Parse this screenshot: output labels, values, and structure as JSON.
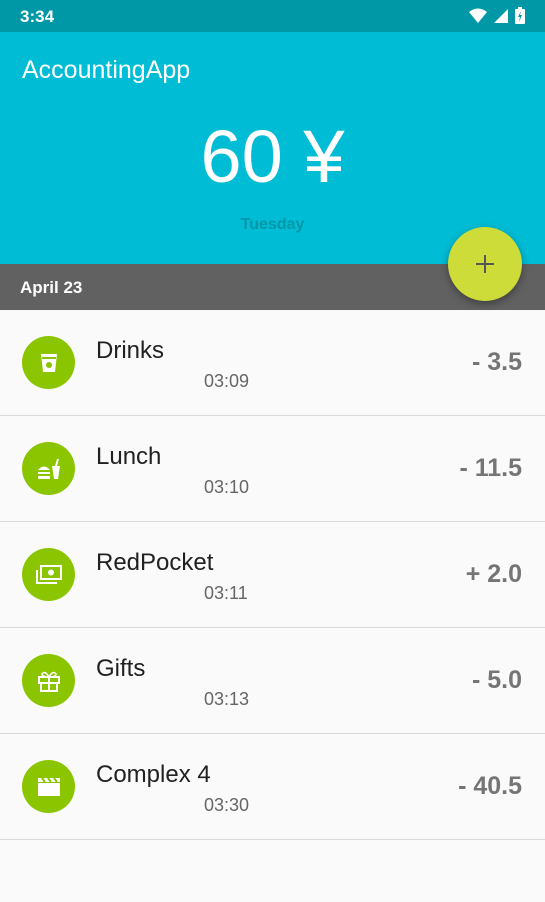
{
  "status": {
    "time": "3:34"
  },
  "app": {
    "title": "AccountingApp"
  },
  "summary": {
    "total": "60 ¥",
    "day": "Tuesday"
  },
  "date_header": "April 23",
  "fab": {
    "icon": "plus-icon"
  },
  "colors": {
    "header": "#00bcd4",
    "status_bar": "#0097a7",
    "date_bar": "#616161",
    "fab": "#cddc39",
    "category_icon_bg": "#8bc500"
  },
  "records": [
    {
      "name": "Drinks",
      "time": "03:09",
      "amount": "- 3.5",
      "icon": "drink-cup-icon"
    },
    {
      "name": "Lunch",
      "time": "03:10",
      "amount": "- 11.5",
      "icon": "fastfood-icon"
    },
    {
      "name": "RedPocket",
      "time": "03:11",
      "amount": "+ 2.0",
      "icon": "money-icon"
    },
    {
      "name": "Gifts",
      "time": "03:13",
      "amount": "- 5.0",
      "icon": "gift-icon"
    },
    {
      "name": "Complex 4",
      "time": "03:30",
      "amount": "- 40.5",
      "icon": "movie-clapper-icon"
    }
  ]
}
